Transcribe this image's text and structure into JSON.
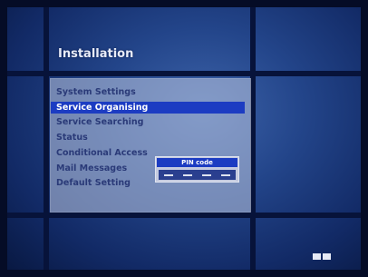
{
  "screen": {
    "title": "Installation"
  },
  "menu": {
    "items": [
      {
        "label": "System Settings",
        "selected": false
      },
      {
        "label": "Service Organising",
        "selected": true
      },
      {
        "label": "Service Searching",
        "selected": false
      },
      {
        "label": "Status",
        "selected": false
      },
      {
        "label": "Conditional Access",
        "selected": false
      },
      {
        "label": "Mail Messages",
        "selected": false
      },
      {
        "label": "Default Setting",
        "selected": false
      }
    ]
  },
  "pin_dialog": {
    "title": "PIN code",
    "placeholder_digits": [
      "-",
      "-",
      "-",
      "-"
    ]
  },
  "colors": {
    "highlight": "#1c3cc2",
    "background": "#23458a",
    "menu_text": "#2a3a78"
  },
  "icons": {
    "corner": "remote-key-icon"
  }
}
